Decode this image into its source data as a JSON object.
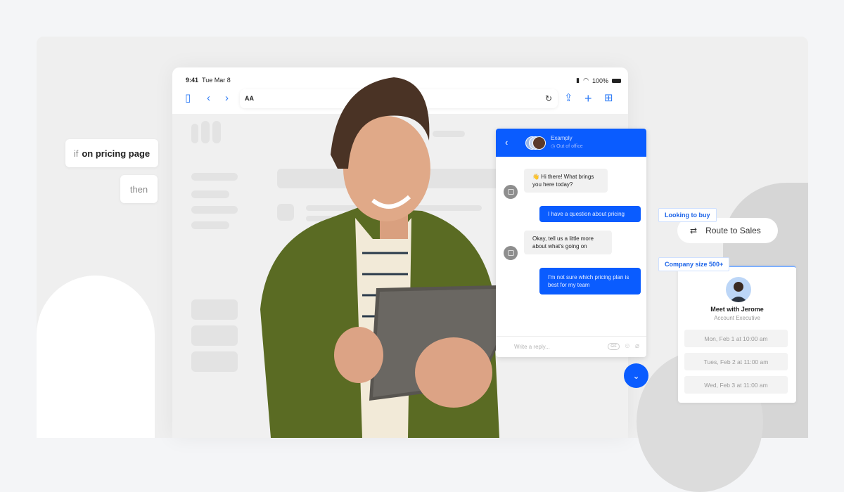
{
  "tablet": {
    "status_time": "9:41",
    "status_date": "Tue Mar 8",
    "battery_percent": "100%",
    "url_text_size_label": "AA",
    "icons": [
      "sidebar-icon",
      "back-icon",
      "forward-icon",
      "reload-icon",
      "share-icon",
      "new-tab-icon",
      "tabs-grid-icon"
    ]
  },
  "rule": {
    "if_keyword": "if",
    "condition": "on pricing page",
    "then_keyword": "then"
  },
  "chat": {
    "brand_name": "Examply",
    "status": "Out of office",
    "messages": [
      {
        "from": "bot",
        "text": "👋 Hi there! What brings you here today?"
      },
      {
        "from": "user",
        "text": "I have a question about pricing"
      },
      {
        "from": "bot",
        "text": "Okay, tell us a little more about what's going on"
      },
      {
        "from": "user",
        "text": "I'm not sure which pricing plan is best for my team"
      }
    ],
    "reply_placeholder": "Write a reply...",
    "gif_label": "GIF",
    "accent_color": "#0a5cff"
  },
  "routing": {
    "tag_intent": "Looking to buy",
    "route_label": "Route to Sales",
    "tag_company": "Company size 500+"
  },
  "meeting": {
    "title": "Meet with Jerome",
    "role": "Account Executive",
    "slots": [
      "Mon, Feb 1 at 10:00 am",
      "Tues, Feb 2 at 11:00 am",
      "Wed, Feb 3 at 11:00 am"
    ]
  }
}
